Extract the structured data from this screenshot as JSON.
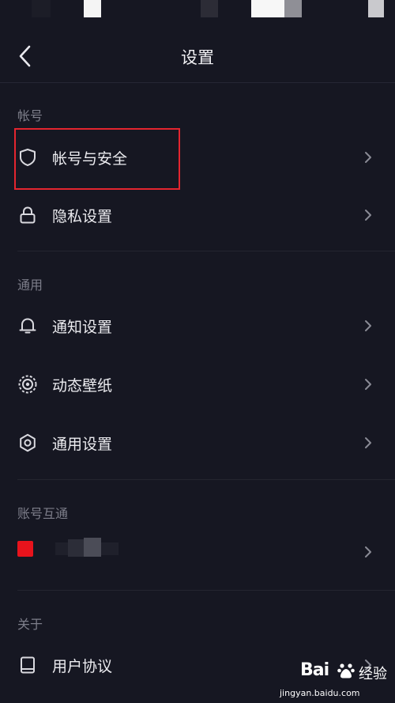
{
  "header": {
    "title": "设置"
  },
  "sections": [
    {
      "label": "帐号",
      "items": [
        {
          "label": "帐号与安全",
          "icon": "shield-icon"
        },
        {
          "label": "隐私设置",
          "icon": "lock-icon"
        }
      ]
    },
    {
      "label": "通用",
      "items": [
        {
          "label": "通知设置",
          "icon": "bell-icon"
        },
        {
          "label": "动态壁纸",
          "icon": "live-wallpaper-icon"
        },
        {
          "label": "通用设置",
          "icon": "gear-icon"
        }
      ]
    },
    {
      "label": "账号互通",
      "items": [
        {
          "label": "",
          "icon": "linked-app-icon"
        }
      ]
    },
    {
      "label": "关于",
      "items": [
        {
          "label": "用户协议",
          "icon": "book-icon"
        }
      ]
    }
  ],
  "watermark": {
    "brand": "Bai",
    "suffix": "经验",
    "url": "jingyan.baidu.com"
  },
  "colors": {
    "background": "#161722",
    "highlight": "#e3252f",
    "accent_red": "#e8131c",
    "muted_text": "#7d7e8a"
  }
}
